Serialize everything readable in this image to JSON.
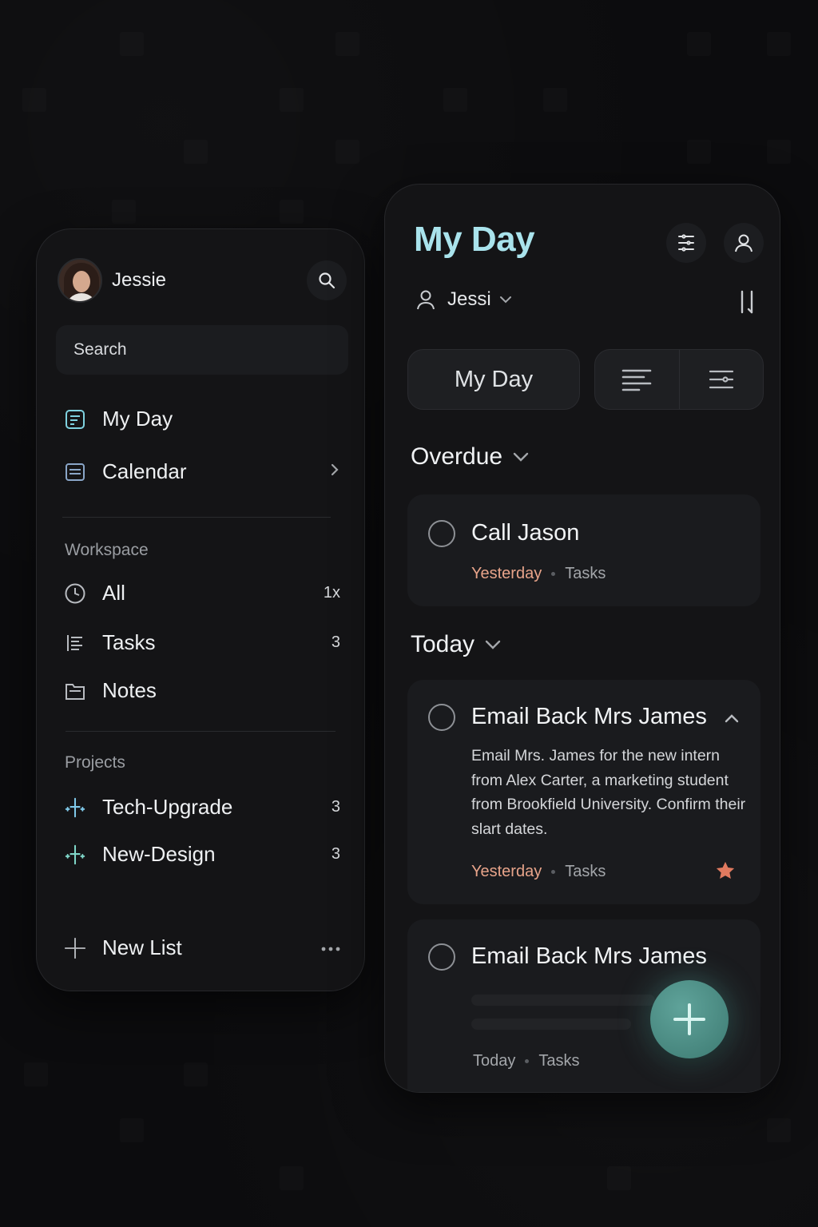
{
  "sidebar": {
    "profile": {
      "name": "Jessie",
      "avatar_icon": "avatar-photo"
    },
    "search": {
      "placeholder": "Search"
    },
    "nav": [
      {
        "label": "My Day",
        "icon": "note-icon"
      },
      {
        "label": "Calendar",
        "icon": "calendar-icon"
      }
    ],
    "workspace": {
      "label": "Workspace",
      "items": [
        {
          "label": "All",
          "count": "1x",
          "icon": "clock-icon"
        },
        {
          "label": "Tasks",
          "count": "3",
          "icon": "list-icon"
        },
        {
          "label": "Notes",
          "count": "",
          "icon": "folder-icon"
        }
      ]
    },
    "projects": {
      "label": "Projects",
      "items": [
        {
          "label": "Tech-Upgrade",
          "count": "3",
          "icon": "sparkle-icon"
        },
        {
          "label": "New-Design",
          "count": "3",
          "icon": "sparkle-icon"
        }
      ]
    },
    "new_list": {
      "label": "New List",
      "more_icon": "ellipsis-icon"
    }
  },
  "main": {
    "title": "My Day",
    "user_select": {
      "name": "Jessi"
    },
    "segment": {
      "label": "My Day"
    },
    "groups": {
      "overdue": {
        "label": "Overdue"
      },
      "today": {
        "label": "Today"
      }
    },
    "tasks": [
      {
        "title": "Call Jason",
        "date": "Yesterday",
        "list": "Tasks"
      },
      {
        "title": "Email Back Mrs James",
        "description": "Email Mrs. James for the new intern from Alex Carter, a marketing student from Brookfield University. Confirm their slart dates.",
        "date": "Yesterday",
        "list": "Tasks",
        "starred": true
      },
      {
        "title": "Email Back Mrs James",
        "date": "Today",
        "list": "Tasks"
      }
    ]
  },
  "colors": {
    "accent": "#a9e3ec",
    "date_overdue": "#e8a48a",
    "star": "#e07a5f",
    "fab": "#4f8f87"
  }
}
